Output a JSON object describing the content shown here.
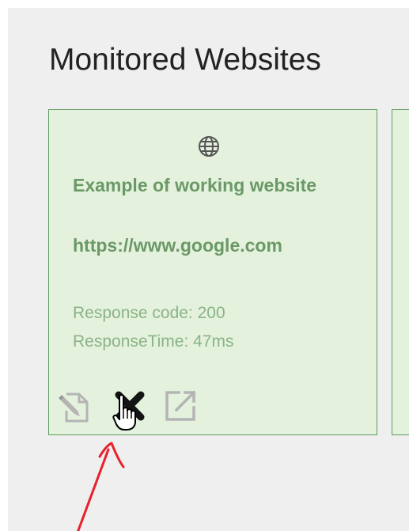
{
  "page": {
    "title": "Monitored Websites"
  },
  "cards": [
    {
      "name": "Example of working website",
      "url": "https://www.google.com",
      "response_code": "Response code: 200",
      "response_time": "ResponseTime: 47ms",
      "icon": "globe-icon",
      "actions": [
        {
          "icon": "edit-icon"
        },
        {
          "icon": "delete-icon"
        },
        {
          "icon": "external-link-icon"
        }
      ]
    }
  ],
  "colors": {
    "page_background": "#efefef",
    "card_background": "#e4f1dd",
    "card_border": "#5f9a5f",
    "title_text": "#6a9966",
    "stat_text": "#8ab486",
    "annotation": "#e8202a"
  }
}
